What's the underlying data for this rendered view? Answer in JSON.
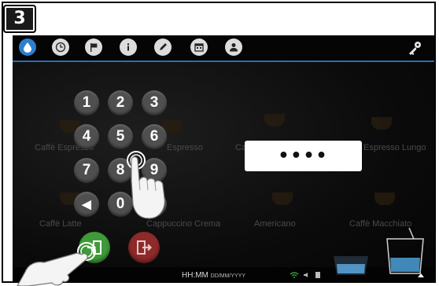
{
  "step_badge": "3",
  "topbar": {
    "icons": [
      "water-drop-icon",
      "clock-icon",
      "flag-icon",
      "info-icon",
      "pencil-icon",
      "calendar-icon",
      "user-icon"
    ],
    "key_icon": "key-icon",
    "accent_color": "#2b7fd0"
  },
  "keypad": {
    "keys": [
      "1",
      "2",
      "3",
      "4",
      "5",
      "6",
      "7",
      "8",
      "9",
      "◀",
      "0",
      "▶"
    ]
  },
  "pin_display": {
    "value": "••••"
  },
  "background_labels": [
    "Caffè Espresso",
    "Espresso",
    "Caffè Crema",
    "Espresso Lungo",
    "Caffè Latte",
    "Cappuccino Crema",
    "Americano",
    "Caffè Macchiato"
  ],
  "buttons": {
    "confirm_icon": "enter-door-icon",
    "confirm_color": "#3f9a3a",
    "cancel_icon": "exit-door-icon",
    "cancel_color": "#8e2a2a"
  },
  "statusbar": {
    "time": "HH:MM",
    "date": "DD/MM/YYYY"
  }
}
